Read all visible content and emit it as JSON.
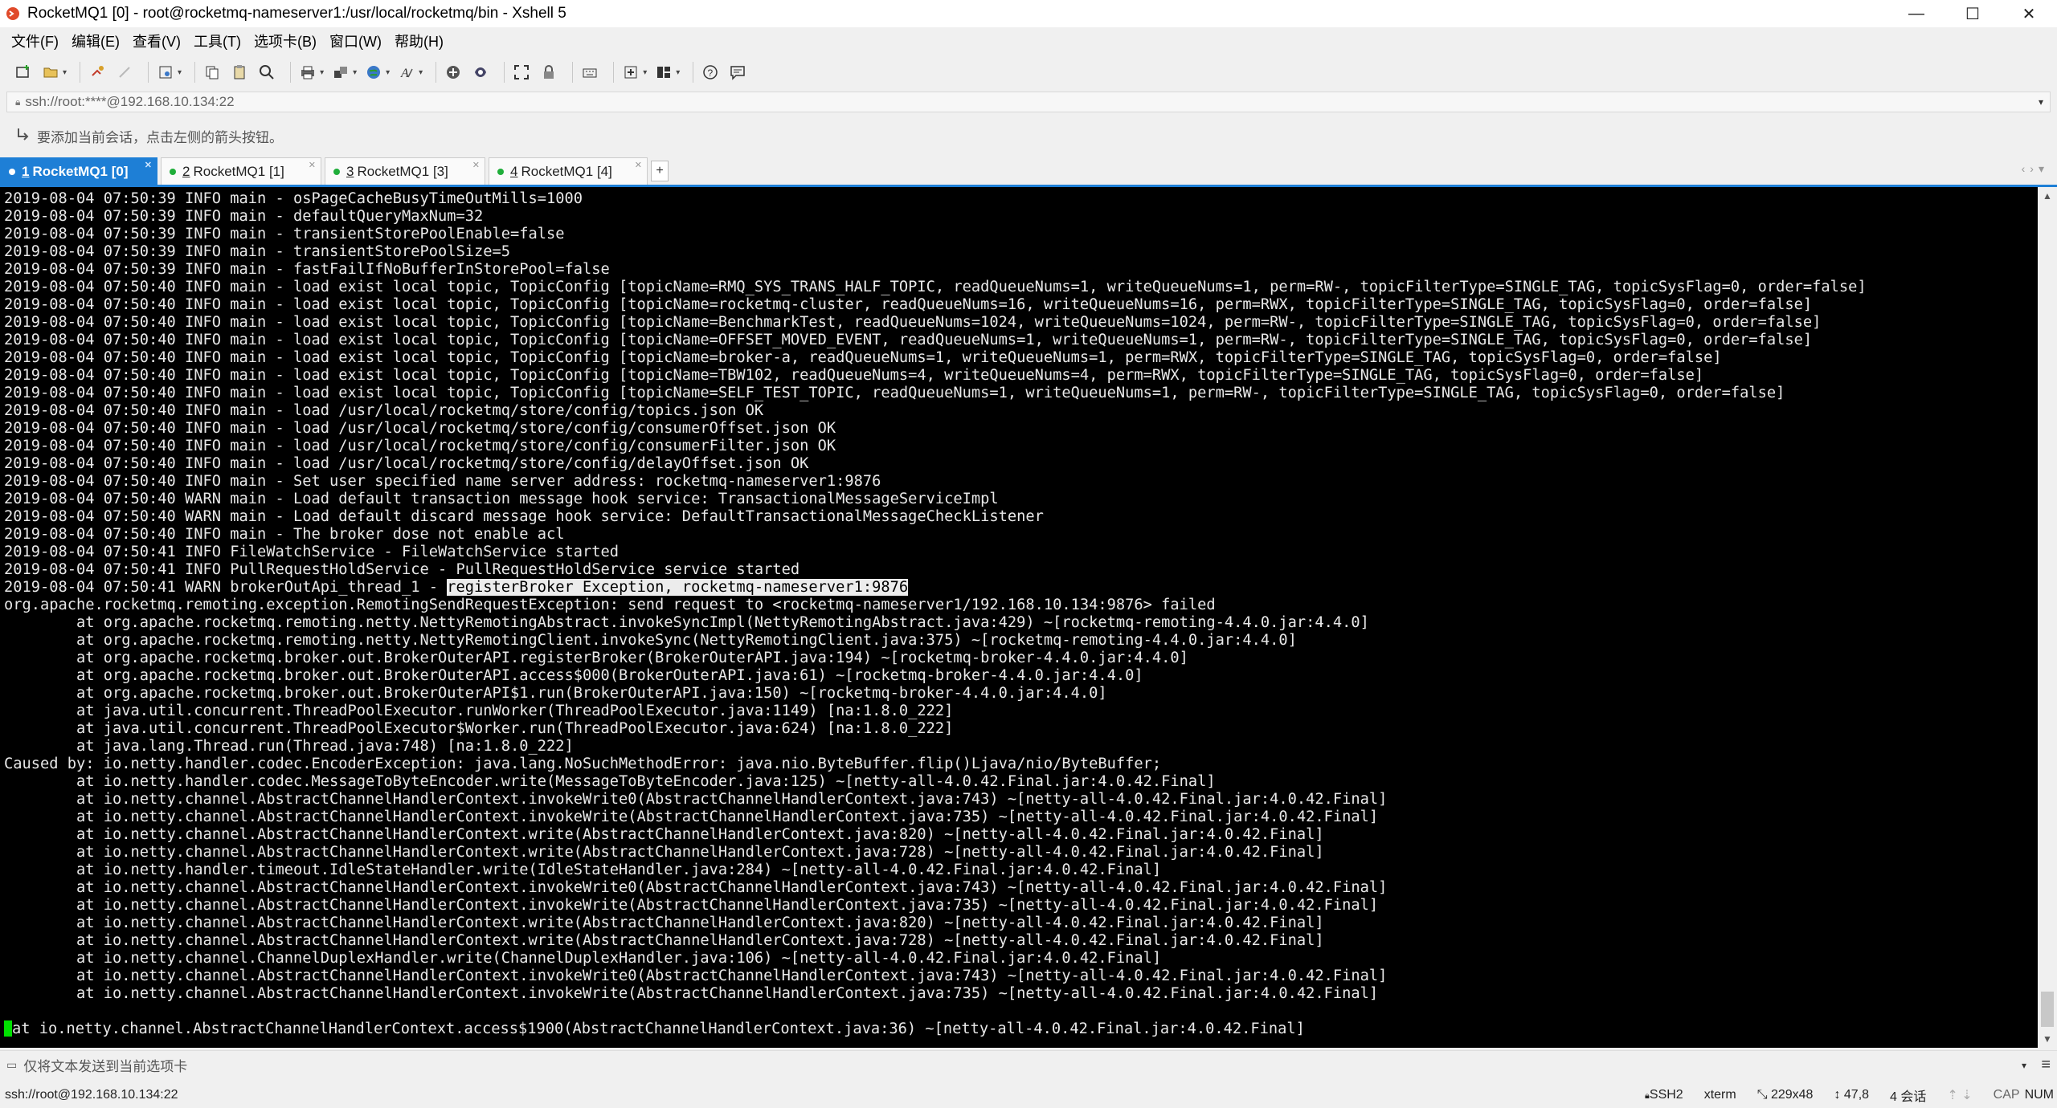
{
  "window": {
    "title": "RocketMQ1 [0] - root@rocketmq-nameserver1:/usr/local/rocketmq/bin - Xshell 5",
    "minimize": "—",
    "maximize": "☐",
    "close": "✕"
  },
  "menu": [
    "文件(F)",
    "编辑(E)",
    "查看(V)",
    "工具(T)",
    "选项卡(B)",
    "窗口(W)",
    "帮助(H)"
  ],
  "address": {
    "value": "ssh://root:****@192.168.10.134:22"
  },
  "hint": "要添加当前会话，点击左侧的箭头按钮。",
  "tabs": [
    {
      "num": "1",
      "label": "RocketMQ1 [0]",
      "active": true
    },
    {
      "num": "2",
      "label": "RocketMQ1 [1]",
      "active": false
    },
    {
      "num": "3",
      "label": "RocketMQ1 [3]",
      "active": false
    },
    {
      "num": "4",
      "label": "RocketMQ1 [4]",
      "active": false
    }
  ],
  "terminal": {
    "lines": [
      "2019-08-04 07:50:39 INFO main - osPageCacheBusyTimeOutMills=1000",
      "2019-08-04 07:50:39 INFO main - defaultQueryMaxNum=32",
      "2019-08-04 07:50:39 INFO main - transientStorePoolEnable=false",
      "2019-08-04 07:50:39 INFO main - transientStorePoolSize=5",
      "2019-08-04 07:50:39 INFO main - fastFailIfNoBufferInStorePool=false",
      "2019-08-04 07:50:40 INFO main - load exist local topic, TopicConfig [topicName=RMQ_SYS_TRANS_HALF_TOPIC, readQueueNums=1, writeQueueNums=1, perm=RW-, topicFilterType=SINGLE_TAG, topicSysFlag=0, order=false]",
      "2019-08-04 07:50:40 INFO main - load exist local topic, TopicConfig [topicName=rocketmq-cluster, readQueueNums=16, writeQueueNums=16, perm=RWX, topicFilterType=SINGLE_TAG, topicSysFlag=0, order=false]",
      "2019-08-04 07:50:40 INFO main - load exist local topic, TopicConfig [topicName=BenchmarkTest, readQueueNums=1024, writeQueueNums=1024, perm=RW-, topicFilterType=SINGLE_TAG, topicSysFlag=0, order=false]",
      "2019-08-04 07:50:40 INFO main - load exist local topic, TopicConfig [topicName=OFFSET_MOVED_EVENT, readQueueNums=1, writeQueueNums=1, perm=RW-, topicFilterType=SINGLE_TAG, topicSysFlag=0, order=false]",
      "2019-08-04 07:50:40 INFO main - load exist local topic, TopicConfig [topicName=broker-a, readQueueNums=1, writeQueueNums=1, perm=RWX, topicFilterType=SINGLE_TAG, topicSysFlag=0, order=false]",
      "2019-08-04 07:50:40 INFO main - load exist local topic, TopicConfig [topicName=TBW102, readQueueNums=4, writeQueueNums=4, perm=RWX, topicFilterType=SINGLE_TAG, topicSysFlag=0, order=false]",
      "2019-08-04 07:50:40 INFO main - load exist local topic, TopicConfig [topicName=SELF_TEST_TOPIC, readQueueNums=1, writeQueueNums=1, perm=RW-, topicFilterType=SINGLE_TAG, topicSysFlag=0, order=false]",
      "2019-08-04 07:50:40 INFO main - load /usr/local/rocketmq/store/config/topics.json OK",
      "2019-08-04 07:50:40 INFO main - load /usr/local/rocketmq/store/config/consumerOffset.json OK",
      "2019-08-04 07:50:40 INFO main - load /usr/local/rocketmq/store/config/consumerFilter.json OK",
      "2019-08-04 07:50:40 INFO main - load /usr/local/rocketmq/store/config/delayOffset.json OK",
      "2019-08-04 07:50:40 INFO main - Set user specified name server address: rocketmq-nameserver1:9876",
      "2019-08-04 07:50:40 WARN main - Load default transaction message hook service: TransactionalMessageServiceImpl",
      "2019-08-04 07:50:40 WARN main - Load default discard message hook service: DefaultTransactionalMessageCheckListener",
      "2019-08-04 07:50:40 INFO main - The broker dose not enable acl",
      "2019-08-04 07:50:41 INFO FileWatchService - FileWatchService started",
      "2019-08-04 07:50:41 INFO PullRequestHoldService - PullRequestHoldService service started",
      "2019-08-04 07:50:41 WARN brokerOutApi_thread_1 - ",
      "org.apache.rocketmq.remoting.exception.RemotingSendRequestException: send request to <rocketmq-nameserver1/192.168.10.134:9876> failed",
      "        at org.apache.rocketmq.remoting.netty.NettyRemotingAbstract.invokeSyncImpl(NettyRemotingAbstract.java:429) ~[rocketmq-remoting-4.4.0.jar:4.4.0]",
      "        at org.apache.rocketmq.remoting.netty.NettyRemotingClient.invokeSync(NettyRemotingClient.java:375) ~[rocketmq-remoting-4.4.0.jar:4.4.0]",
      "        at org.apache.rocketmq.broker.out.BrokerOuterAPI.registerBroker(BrokerOuterAPI.java:194) ~[rocketmq-broker-4.4.0.jar:4.4.0]",
      "        at org.apache.rocketmq.broker.out.BrokerOuterAPI.access$000(BrokerOuterAPI.java:61) ~[rocketmq-broker-4.4.0.jar:4.4.0]",
      "        at org.apache.rocketmq.broker.out.BrokerOuterAPI$1.run(BrokerOuterAPI.java:150) ~[rocketmq-broker-4.4.0.jar:4.4.0]",
      "        at java.util.concurrent.ThreadPoolExecutor.runWorker(ThreadPoolExecutor.java:1149) [na:1.8.0_222]",
      "        at java.util.concurrent.ThreadPoolExecutor$Worker.run(ThreadPoolExecutor.java:624) [na:1.8.0_222]",
      "        at java.lang.Thread.run(Thread.java:748) [na:1.8.0_222]",
      "Caused by: io.netty.handler.codec.EncoderException: java.lang.NoSuchMethodError: java.nio.ByteBuffer.flip()Ljava/nio/ByteBuffer;",
      "        at io.netty.handler.codec.MessageToByteEncoder.write(MessageToByteEncoder.java:125) ~[netty-all-4.0.42.Final.jar:4.0.42.Final]",
      "        at io.netty.channel.AbstractChannelHandlerContext.invokeWrite0(AbstractChannelHandlerContext.java:743) ~[netty-all-4.0.42.Final.jar:4.0.42.Final]",
      "        at io.netty.channel.AbstractChannelHandlerContext.invokeWrite(AbstractChannelHandlerContext.java:735) ~[netty-all-4.0.42.Final.jar:4.0.42.Final]",
      "        at io.netty.channel.AbstractChannelHandlerContext.write(AbstractChannelHandlerContext.java:820) ~[netty-all-4.0.42.Final.jar:4.0.42.Final]",
      "        at io.netty.channel.AbstractChannelHandlerContext.write(AbstractChannelHandlerContext.java:728) ~[netty-all-4.0.42.Final.jar:4.0.42.Final]",
      "        at io.netty.handler.timeout.IdleStateHandler.write(IdleStateHandler.java:284) ~[netty-all-4.0.42.Final.jar:4.0.42.Final]",
      "        at io.netty.channel.AbstractChannelHandlerContext.invokeWrite0(AbstractChannelHandlerContext.java:743) ~[netty-all-4.0.42.Final.jar:4.0.42.Final]",
      "        at io.netty.channel.AbstractChannelHandlerContext.invokeWrite(AbstractChannelHandlerContext.java:735) ~[netty-all-4.0.42.Final.jar:4.0.42.Final]",
      "        at io.netty.channel.AbstractChannelHandlerContext.write(AbstractChannelHandlerContext.java:820) ~[netty-all-4.0.42.Final.jar:4.0.42.Final]",
      "        at io.netty.channel.AbstractChannelHandlerContext.write(AbstractChannelHandlerContext.java:728) ~[netty-all-4.0.42.Final.jar:4.0.42.Final]",
      "        at io.netty.channel.ChannelDuplexHandler.write(ChannelDuplexHandler.java:106) ~[netty-all-4.0.42.Final.jar:4.0.42.Final]",
      "        at io.netty.channel.AbstractChannelHandlerContext.invokeWrite0(AbstractChannelHandlerContext.java:743) ~[netty-all-4.0.42.Final.jar:4.0.42.Final]",
      "        at io.netty.channel.AbstractChannelHandlerContext.invokeWrite(AbstractChannelHandlerContext.java:735) ~[netty-all-4.0.42.Final.jar:4.0.42.Final]",
      "        ",
      "at io.netty.channel.AbstractChannelHandlerContext.access$1900(AbstractChannelHandlerContext.java:36) ~[netty-all-4.0.42.Final.jar:4.0.42.Final]"
    ],
    "highlight": "registerBroker Exception, rocketmq-nameserver1:9876"
  },
  "sendbar": {
    "text": "仅将文本发送到当前选项卡"
  },
  "status": {
    "connection": "ssh://root@192.168.10.134:22",
    "protocol": "SSH2",
    "terminal_type": "xterm",
    "size": "229x48",
    "cursor_pos": "47,8",
    "sessions": "4 会话",
    "caps": "CAP",
    "num": "NUM"
  },
  "colors": {
    "accent": "#1e7fd6",
    "terminal_bg": "#000000",
    "terminal_fg": "#e8e8e8",
    "cursor": "#00e000"
  }
}
